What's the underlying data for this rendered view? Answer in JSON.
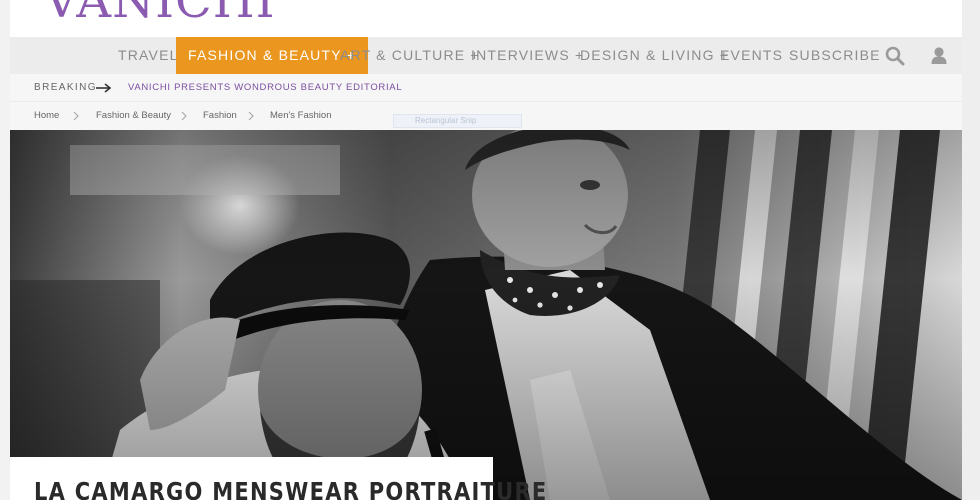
{
  "site": {
    "logo_text": "VANICHI"
  },
  "nav": {
    "items": [
      {
        "label": "TRAVEL",
        "has_sub": false,
        "active": false
      },
      {
        "label": "FASHION & BEAUTY +",
        "has_sub": true,
        "active": true
      },
      {
        "label": "ART & CULTURE +",
        "has_sub": true,
        "active": false
      },
      {
        "label": "INTERVIEWS +",
        "has_sub": true,
        "active": false
      },
      {
        "label": "DESIGN & LIVING +",
        "has_sub": true,
        "active": false
      },
      {
        "label": "EVENTS",
        "has_sub": false,
        "active": false
      },
      {
        "label": "SUBSCRIBE",
        "has_sub": false,
        "active": false
      }
    ],
    "icons": [
      "search-icon",
      "user-icon"
    ],
    "active_color": "#ea961f"
  },
  "breaking": {
    "label": "BREAKING",
    "headline": "VANICHI PRESENTS WONDROUS BEAUTY EDITORIAL"
  },
  "breadcrumb": [
    "Home",
    "Fashion & Beauty",
    "Fashion",
    "Men's Fashion"
  ],
  "overlay": {
    "snip_label": "Rectangular Snip"
  },
  "article": {
    "title": "LA CAMARGO MENSWEAR PORTRAITURE"
  },
  "colors": {
    "brand": "#8a5bb0",
    "accent": "#ea961f"
  }
}
